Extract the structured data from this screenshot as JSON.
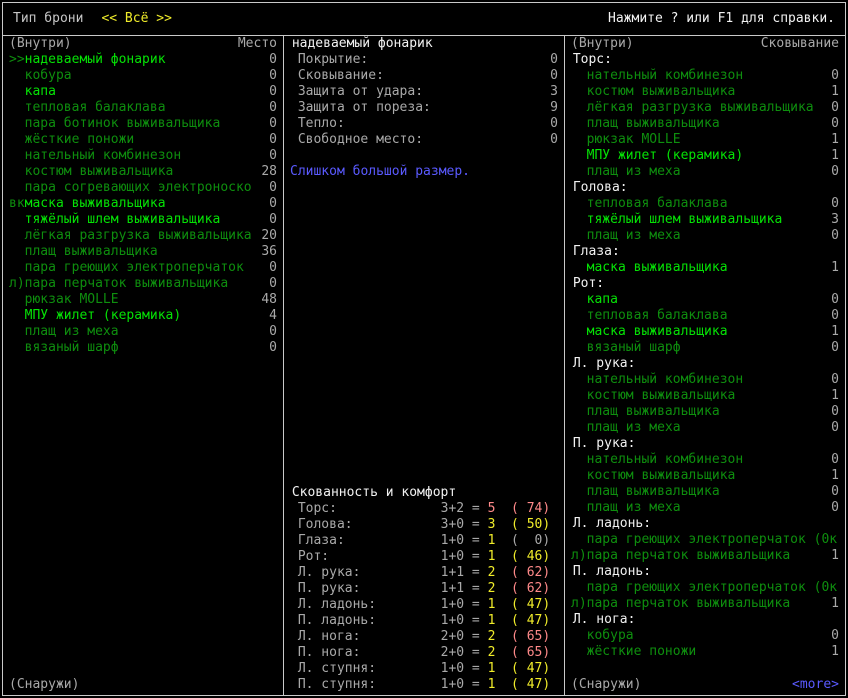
{
  "colors": {
    "bright_green": "#05e205",
    "dim_green": "#0e8e0e",
    "yellow": "#f0ec2a",
    "light_red": "#ff8a8a",
    "blue": "#5a5aff",
    "gray": "#a9a9a9",
    "white": "#f2f2f2"
  },
  "top_bar": {
    "left_label": "Тип брони",
    "filter": "<< Всё >>",
    "help": "Нажмите ? или F1 для справки."
  },
  "left_panel": {
    "header_left": "(Внутри)",
    "header_right": "Место",
    "footer": "(Снаружи)",
    "items": [
      {
        "prefix": ">>",
        "name": "надеваемый фонарик",
        "value": "0",
        "bright": true
      },
      {
        "prefix": "",
        "name": "кобура",
        "value": "0",
        "bright": false
      },
      {
        "prefix": "",
        "name": "капа",
        "value": "0",
        "bright": true
      },
      {
        "prefix": "",
        "name": "тепловая балаклава",
        "value": "0",
        "bright": false
      },
      {
        "prefix": "",
        "name": "пара ботинок выживальщика",
        "value": "0",
        "bright": false
      },
      {
        "prefix": "",
        "name": "жёсткие поножи",
        "value": "0",
        "bright": false
      },
      {
        "prefix": "",
        "name": "нательный комбинезон",
        "value": "0",
        "bright": false
      },
      {
        "prefix": "",
        "name": "костюм выживальщика",
        "value": "28",
        "bright": false
      },
      {
        "prefix": "",
        "name": "пара согревающих электроноско",
        "value": "0",
        "bright": false
      },
      {
        "prefix": "вк",
        "name": "маска выживальщика",
        "value": "0",
        "bright": true
      },
      {
        "prefix": "",
        "name": "тяжёлый шлем выживальщика",
        "value": "0",
        "bright": true
      },
      {
        "prefix": "",
        "name": "лёгкая разгрузка выживальщика",
        "value": "20",
        "bright": false
      },
      {
        "prefix": "",
        "name": "плащ выживальщика",
        "value": "36",
        "bright": false
      },
      {
        "prefix": "",
        "name": "пара греющих электроперчаток",
        "value": "0",
        "bright": false
      },
      {
        "prefix": "л)",
        "name": "пара перчаток выживальщика",
        "value": "0",
        "bright": false
      },
      {
        "prefix": "",
        "name": "рюкзак MOLLE",
        "value": "48",
        "bright": false
      },
      {
        "prefix": "",
        "name": "МПУ жилет (керамика)",
        "value": "4",
        "bright": true
      },
      {
        "prefix": "",
        "name": "плащ из меха",
        "value": "0",
        "bright": false
      },
      {
        "prefix": "",
        "name": "вязаный шарф",
        "value": "0",
        "bright": false
      }
    ]
  },
  "middle_panel": {
    "title": "надеваемый фонарик",
    "stats": [
      {
        "label": "Покрытие:",
        "value": "0"
      },
      {
        "label": "Сковывание:",
        "value": "0"
      },
      {
        "label": "Защита от удара:",
        "value": "3"
      },
      {
        "label": "Защита от пореза:",
        "value": "9"
      },
      {
        "label": "Тепло:",
        "value": "0"
      },
      {
        "label": "Свободное место:",
        "value": "0"
      }
    ],
    "warning": "Слишком большой размер.",
    "encumbrance": {
      "title": "Скованность и комфорт",
      "rows": [
        {
          "label": "Торс:",
          "formula": "3+2",
          "result": "5",
          "result_color": "lightred",
          "warmth": "( 74)",
          "warmth_color": "lightred"
        },
        {
          "label": "Голова:",
          "formula": "3+0",
          "result": "3",
          "result_color": "yellow",
          "warmth": "( 50)",
          "warmth_color": "yellow"
        },
        {
          "label": "Глаза:",
          "formula": "1+0",
          "result": "1",
          "result_color": "yellow",
          "warmth": "(  0)",
          "warmth_color": "gray"
        },
        {
          "label": "Рот:",
          "formula": "1+0",
          "result": "1",
          "result_color": "yellow",
          "warmth": "( 46)",
          "warmth_color": "yellow"
        },
        {
          "label": "Л. рука:",
          "formula": "1+1",
          "result": "2",
          "result_color": "yellow",
          "warmth": "( 62)",
          "warmth_color": "lightred"
        },
        {
          "label": "П. рука:",
          "formula": "1+1",
          "result": "2",
          "result_color": "yellow",
          "warmth": "( 62)",
          "warmth_color": "lightred"
        },
        {
          "label": "Л. ладонь:",
          "formula": "1+0",
          "result": "1",
          "result_color": "yellow",
          "warmth": "( 47)",
          "warmth_color": "yellow"
        },
        {
          "label": "П. ладонь:",
          "formula": "1+0",
          "result": "1",
          "result_color": "yellow",
          "warmth": "( 47)",
          "warmth_color": "yellow"
        },
        {
          "label": "Л. нога:",
          "formula": "2+0",
          "result": "2",
          "result_color": "yellow",
          "warmth": "( 65)",
          "warmth_color": "lightred"
        },
        {
          "label": "П. нога:",
          "formula": "2+0",
          "result": "2",
          "result_color": "yellow",
          "warmth": "( 65)",
          "warmth_color": "lightred"
        },
        {
          "label": "Л. ступня:",
          "formula": "1+0",
          "result": "1",
          "result_color": "yellow",
          "warmth": "( 47)",
          "warmth_color": "yellow"
        },
        {
          "label": "П. ступня:",
          "formula": "1+0",
          "result": "1",
          "result_color": "yellow",
          "warmth": "( 47)",
          "warmth_color": "yellow"
        }
      ]
    }
  },
  "right_panel": {
    "header_left": "(Внутри)",
    "header_right": "Сковывание",
    "footer_left": "(Снаружи)",
    "footer_right": "<more>",
    "sections": [
      {
        "title": "Торс:",
        "items": [
          {
            "prefix": "",
            "name": "нательный комбинезон",
            "value": "0",
            "bright": false
          },
          {
            "prefix": "",
            "name": "костюм выживальщика",
            "value": "1",
            "bright": false
          },
          {
            "prefix": "",
            "name": "лёгкая разгрузка выживальщика",
            "value": "0",
            "bright": false
          },
          {
            "prefix": "",
            "name": "плащ выживальщика",
            "value": "0",
            "bright": false
          },
          {
            "prefix": "",
            "name": "рюкзак MOLLE",
            "value": "1",
            "bright": false
          },
          {
            "prefix": "",
            "name": "МПУ жилет (керамика)",
            "value": "1",
            "bright": true
          },
          {
            "prefix": "",
            "name": "плащ из меха",
            "value": "0",
            "bright": false
          }
        ]
      },
      {
        "title": "Голова:",
        "items": [
          {
            "prefix": "",
            "name": "тепловая балаклава",
            "value": "0",
            "bright": false
          },
          {
            "prefix": "",
            "name": "тяжёлый шлем выживальщика",
            "value": "3",
            "bright": true
          },
          {
            "prefix": "",
            "name": "плащ из меха",
            "value": "0",
            "bright": false
          }
        ]
      },
      {
        "title": "Глаза:",
        "items": [
          {
            "prefix": "",
            "name": "маска выживальщика",
            "value": "1",
            "bright": true
          }
        ]
      },
      {
        "title": "Рот:",
        "items": [
          {
            "prefix": "",
            "name": "капа",
            "value": "0",
            "bright": true
          },
          {
            "prefix": "",
            "name": "тепловая балаклава",
            "value": "0",
            "bright": false
          },
          {
            "prefix": "",
            "name": "маска выживальщика",
            "value": "1",
            "bright": true
          },
          {
            "prefix": "",
            "name": "вязаный шарф",
            "value": "0",
            "bright": false
          }
        ]
      },
      {
        "title": "Л. рука:",
        "items": [
          {
            "prefix": "",
            "name": "нательный комбинезон",
            "value": "0",
            "bright": false
          },
          {
            "prefix": "",
            "name": "костюм выживальщика",
            "value": "1",
            "bright": false
          },
          {
            "prefix": "",
            "name": "плащ выживальщика",
            "value": "0",
            "bright": false
          },
          {
            "prefix": "",
            "name": "плащ из меха",
            "value": "0",
            "bright": false
          }
        ]
      },
      {
        "title": "П. рука:",
        "items": [
          {
            "prefix": "",
            "name": "нательный комбинезон",
            "value": "0",
            "bright": false
          },
          {
            "prefix": "",
            "name": "костюм выживальщика",
            "value": "1",
            "bright": false
          },
          {
            "prefix": "",
            "name": "плащ выживальщика",
            "value": "0",
            "bright": false
          },
          {
            "prefix": "",
            "name": "плащ из меха",
            "value": "0",
            "bright": false
          }
        ]
      },
      {
        "title": "Л. ладонь:",
        "items": [
          {
            "prefix": "",
            "name": "пара греющих электроперчаток (0к",
            "bright": false
          },
          {
            "prefix": "л)",
            "name": "пара перчаток выживальщика",
            "value": "1",
            "bright": false
          }
        ]
      },
      {
        "title": "П. ладонь:",
        "items": [
          {
            "prefix": "",
            "name": "пара греющих электроперчаток (0к",
            "bright": false
          },
          {
            "prefix": "л)",
            "name": "пара перчаток выживальщика",
            "value": "1",
            "bright": false
          }
        ]
      },
      {
        "title": "Л. нога:",
        "items": [
          {
            "prefix": "",
            "name": "кобура",
            "value": "0",
            "bright": false
          },
          {
            "prefix": "",
            "name": "жёсткие поножи",
            "value": "1",
            "bright": false
          }
        ]
      }
    ]
  }
}
